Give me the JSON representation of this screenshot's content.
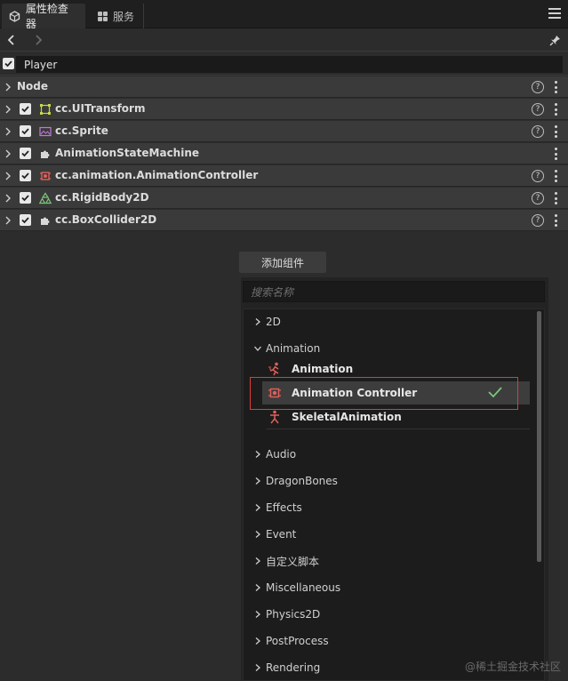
{
  "tabs": [
    {
      "label": "属性检查器",
      "icon": "inspector-icon"
    },
    {
      "label": "服务",
      "icon": "services-icon"
    }
  ],
  "node_name": {
    "checked": true,
    "value": "Player"
  },
  "node_section": {
    "label": "Node"
  },
  "components": [
    {
      "label": "cc.UITransform",
      "icon": "ui-transform-icon",
      "help": true
    },
    {
      "label": "cc.Sprite",
      "icon": "sprite-icon",
      "help": true
    },
    {
      "label": "AnimationStateMachine",
      "icon": "script-component-icon",
      "help": false
    },
    {
      "label": "cc.animation.AnimationController",
      "icon": "animation-controller-icon",
      "help": true
    },
    {
      "label": "cc.RigidBody2D",
      "icon": "rigidbody-icon",
      "help": true
    },
    {
      "label": "cc.BoxCollider2D",
      "icon": "collider-icon",
      "help": true
    }
  ],
  "help_glyph": "?",
  "add_component": {
    "label": "添加组件"
  },
  "search": {
    "placeholder": "搜索名称"
  },
  "categories": [
    {
      "label": "2D",
      "expanded": false
    },
    {
      "label": "Animation",
      "expanded": true,
      "items": [
        {
          "label": "Animation",
          "icon": "animation-run-icon"
        },
        {
          "label": "Animation Controller",
          "icon": "animation-controller-icon",
          "selected": true
        },
        {
          "label": "SkeletalAnimation",
          "icon": "skeletal-animation-icon"
        }
      ]
    },
    {
      "label": "Audio",
      "expanded": false
    },
    {
      "label": "DragonBones",
      "expanded": false
    },
    {
      "label": "Effects",
      "expanded": false
    },
    {
      "label": "Event",
      "expanded": false
    },
    {
      "label": "自定义脚本",
      "expanded": false
    },
    {
      "label": "Miscellaneous",
      "expanded": false
    },
    {
      "label": "Physics2D",
      "expanded": false
    },
    {
      "label": "PostProcess",
      "expanded": false
    },
    {
      "label": "Rendering",
      "expanded": false
    }
  ],
  "watermark": "@稀土掘金技术社区",
  "colors": {
    "highlight_box": "#e23b3b",
    "check_ok": "#7bc67b",
    "icon_red": "#e0605a"
  }
}
